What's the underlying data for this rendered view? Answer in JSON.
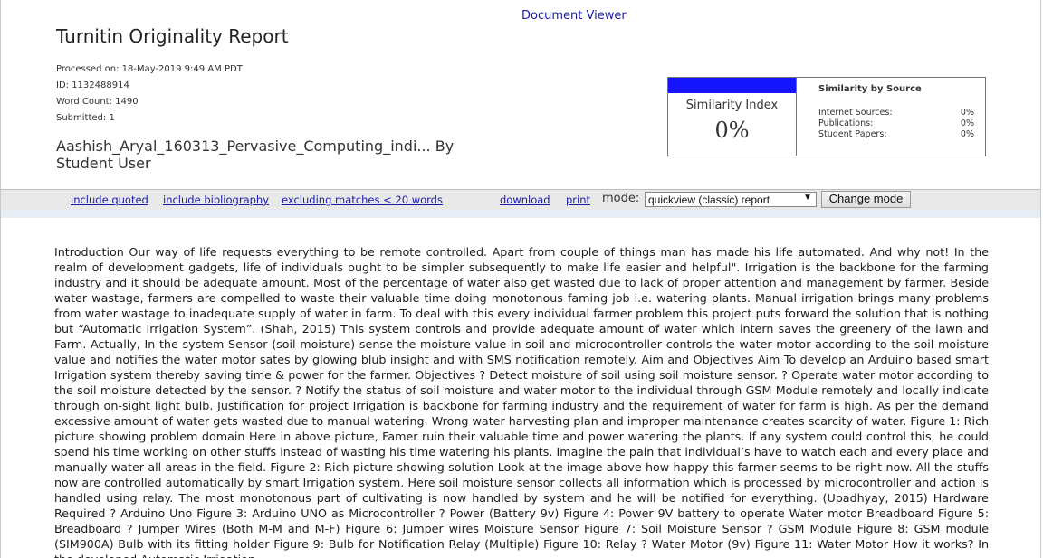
{
  "viewer": {
    "title": "Document Viewer"
  },
  "report": {
    "title": "Turnitin Originality Report",
    "processed_on": "Processed on: 18-May-2019 9:49 AM PDT",
    "id": "ID: 1132488914",
    "word_count": "Word Count: 1490",
    "submitted": "Submitted: 1",
    "doc_title": "Aashish_Aryal_160313_Pervasive_Computing_indi... By Student User"
  },
  "similarity": {
    "index_label": "Similarity Index",
    "index_value": "0%",
    "bar_color": "#1414ff",
    "by_source_title": "Similarity by Source",
    "sources": [
      {
        "label": "Internet Sources:",
        "value": "0%"
      },
      {
        "label": "Publications:",
        "value": "0%"
      },
      {
        "label": "Student Papers:",
        "value": "0%"
      }
    ]
  },
  "toolbar": {
    "include_quoted": "include quoted",
    "include_bibliography": "include bibliography",
    "excluding_matches": "excluding matches < 20 words",
    "download": "download",
    "print": "print",
    "mode_label": "mode:",
    "mode_value": "quickview (classic) report",
    "change_mode": "Change mode"
  },
  "content": {
    "text": "Introduction Our way of life requests everything to be remote controlled. Apart from couple of things man has made his life automated. And why not! In the realm of development gadgets, life of individuals ought to be simpler subsequently to make life easier and helpful\". Irrigation is the backbone for the farming industry and it should be adequate amount. Most of the percentage of water also get wasted due to lack of proper attention and management by farmer. Beside water wastage, farmers are compelled to waste their valuable time doing monotonous faming job i.e. watering plants. Manual irrigation brings many problems from water wastage to inadequate supply of water in farm. To deal with this every individual farmer problem this project puts forward the solution that is nothing but “Automatic Irrigation System”. (Shah, 2015) This system controls and provide adequate amount of water which intern saves the greenery of the lawn and Farm. Actually, In the system Sensor (soil moisture) sense the moisture value in soil and microcontroller controls the water motor according to the soil moisture value and notifies the water motor sates by glowing blub insight and with SMS notification remotely. Aim and Objectives Aim To develop an Arduino based smart Irrigation system thereby saving time & power for the farmer. Objectives ? Detect moisture of soil using soil moisture sensor. ? Operate water motor according to the soil moisture detected by the sensor. ? Notify the status of soil moisture and water motor to the individual through GSM Module remotely and locally indicate through on-sight light bulb. Justification for project Irrigation is backbone for farming industry and the requirement of water for farm is high. As per the demand excessive amount of water gets wasted due to manual watering. Wrong water harvesting plan and improper maintenance creates scarcity of water. Figure 1: Rich picture showing problem domain Here in above picture, Famer ruin their valuable time and power watering the plants. If any system could control this, he could spend his time working on other stuffs instead of wasting his time watering his plants. Imagine the pain that individual’s have to watch each and every place and manually water all areas in the field. Figure 2: Rich picture showing solution Look at the image above how happy this farmer seems to be right now. All the stuffs now are controlled automatically by smart Irrigation system. Here soil moisture sensor collects all information which is processed by microcontroller and action is handled using relay. The most monotonous part of cultivating is now handled by system and he will be notified for everything. (Upadhyay, 2015) Hardware Required ? Arduino Uno Figure 3: Arduino UNO as Microcontroller ? Power (Battery 9v) Figure 4: Power 9V battery to operate Water motor Breadboard Figure 5: Breadboard ? Jumper Wires (Both M-M and M-F) Figure 6: Jumper wires Moisture Sensor Figure 7: Soil Moisture Sensor ? GSM Module Figure 8: GSM module (SIM900A) Bulb with its fitting holder Figure 9: Bulb for Notification Relay (Multiple) Figure 10: Relay ? Water Motor (9v) Figure 11: Water Motor How it works? In the developed Automatic Irrigation"
  }
}
